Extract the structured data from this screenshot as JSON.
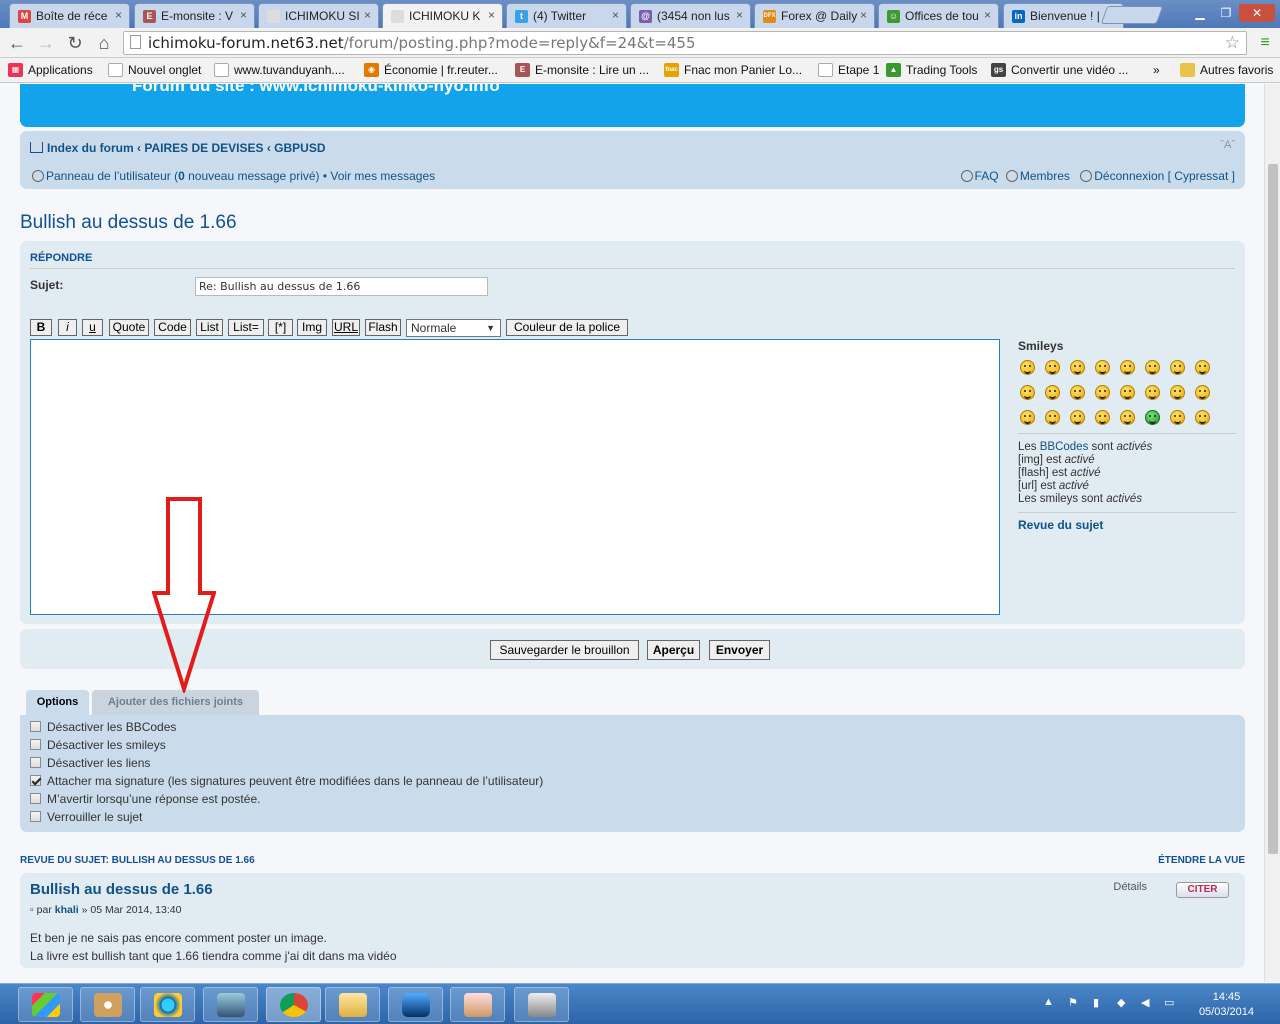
{
  "browser": {
    "tabs": [
      {
        "label": "Boîte de réce",
        "fav": "M",
        "color": "#d44"
      },
      {
        "label": "E-monsite : V",
        "fav": "E",
        "color": "#a55"
      },
      {
        "label": "ICHIMOKU SI",
        "fav": "",
        "color": "#ddd"
      },
      {
        "label": "ICHIMOKU K",
        "fav": "",
        "color": "#ddd"
      },
      {
        "label": "(4) Twitter",
        "fav": "t",
        "color": "#3aa0e8"
      },
      {
        "label": "(3454 non lus",
        "fav": "@",
        "color": "#7a5fb0"
      },
      {
        "label": "Forex @ Daily",
        "fav": "DFX",
        "color": "#e08a1a"
      },
      {
        "label": "Offices de tou",
        "fav": "☺",
        "color": "#3c9a30"
      },
      {
        "label": "Bienvenue ! |",
        "fav": "in",
        "color": "#0a66c2"
      }
    ],
    "url_host": "ichimoku-forum.net63.net",
    "url_path": "/forum/posting.php?mode=reply&f=24&t=455",
    "bookmarks": [
      {
        "label": "Applications",
        "fav": "▦",
        "color": "#e35"
      },
      {
        "label": "Nouvel onglet",
        "fav": "",
        "color": "#ddd"
      },
      {
        "label": "www.tuvanduyanh....",
        "fav": "",
        "color": "#ddd"
      },
      {
        "label": "Économie | fr.reuter...",
        "fav": "◉",
        "color": "#e07a00"
      },
      {
        "label": "E-monsite : Lire un ...",
        "fav": "E",
        "color": "#a55"
      },
      {
        "label": "Fnac mon Panier Lo...",
        "fav": "fnac",
        "color": "#e4a400"
      },
      {
        "label": "Etape 1",
        "fav": "",
        "color": "#ddd"
      },
      {
        "label": "Trading Tools",
        "fav": "▲",
        "color": "#3a9a30"
      },
      {
        "label": "Convertir une vidéo ...",
        "fav": "gs",
        "color": "#444"
      },
      {
        "label": "»",
        "fav": "",
        "color": "none"
      },
      {
        "label": "Autres favoris",
        "fav": "",
        "color": "#e8c24a"
      }
    ]
  },
  "header": {
    "banner_text": "Forum du site : www.ichimoku-kinko-hyo.info"
  },
  "nav": {
    "crumbs": [
      "Index du forum",
      "PAIRES DE DEVISES",
      "GBPUSD"
    ],
    "font_size": "ˇAˆ",
    "ucp_prefix": "Panneau de l’utilisateur (",
    "ucp_count": "0",
    "ucp_suffix": " nouveau message privé) •",
    "view_messages": "Voir mes messages",
    "faq": "FAQ",
    "members": "Membres",
    "logout": "Déconnexion [ Cypressat ]"
  },
  "topic": {
    "title": "Bullish au dessus de 1.66"
  },
  "reply": {
    "heading": "RÉPONDRE",
    "subject_label": "Sujet:",
    "subject_value": "Re: Bullish au dessus de 1.66",
    "bbcode": {
      "b": "B",
      "i": "i",
      "u": "u",
      "quote": "Quote",
      "code": "Code",
      "list": "List",
      "listeq": "List=",
      "star": "[*]",
      "img": "Img",
      "url": "URL",
      "flash": "Flash",
      "size": "Normale",
      "color": "Couleur de la police"
    },
    "message": "",
    "smileys_title": "Smileys",
    "bbcodes_link": "BBCodes",
    "info_les": "Les ",
    "info_sont": " sont ",
    "info_active_pl": "activés",
    "info_img": "[img] est ",
    "info_flash": "[flash] est ",
    "info_url": "[url] est ",
    "info_active": "activé",
    "info_smileys": "Les smileys sont ",
    "topic_review_link": "Revue du sujet"
  },
  "buttons": {
    "draft": "Sauvegarder le brouillon",
    "preview": "Aperçu",
    "submit": "Envoyer"
  },
  "options": {
    "tab_options": "Options",
    "tab_attach": "Ajouter des fichiers joints",
    "items": [
      {
        "label": "Désactiver les BBCodes",
        "checked": false
      },
      {
        "label": "Désactiver les smileys",
        "checked": false
      },
      {
        "label": "Désactiver les liens",
        "checked": false
      },
      {
        "label": "Attacher ma signature (les signatures peuvent être modifiées dans le panneau de l’utilisateur)",
        "checked": true
      },
      {
        "label": "M’avertir lorsqu’une réponse est postée.",
        "checked": false
      },
      {
        "label": "Verrouiller le sujet",
        "checked": false
      }
    ]
  },
  "review": {
    "heading": "REVUE DU SUJET: BULLISH AU DESSUS DE 1.66",
    "expand": "ÉTENDRE LA VUE",
    "post_title": "Bullish au dessus de 1.66",
    "by": "par ",
    "author": "khali",
    "date": " » 05 Mar 2014, 13:40",
    "details": "Détails",
    "quote": "CITER",
    "line1": "Et ben je ne sais pas encore comment poster un image.",
    "line2": "La livre est bullish tant que 1.66 tiendra comme j'ai dit dans ma vidéo"
  },
  "taskbar": {
    "time": "14:45",
    "date": "05/03/2014"
  }
}
